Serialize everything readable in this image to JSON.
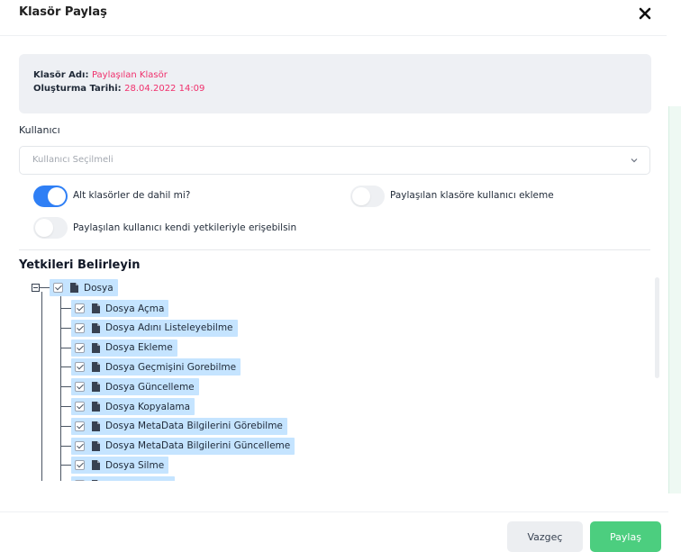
{
  "modal": {
    "title": "Klasör Paylaş",
    "close_icon": "close-icon"
  },
  "folder_info": {
    "name_label": "Klasör Adı:",
    "name_value": "Paylaşılan Klasör",
    "date_label": "Oluşturma Tarihi:",
    "date_value": "28.04.2022 14:09"
  },
  "user_field": {
    "label": "Kullanıcı",
    "placeholder": "Kullanıcı Seçilmeli"
  },
  "toggles": {
    "subfolders": {
      "label": "Alt klasörler de dahil mi?",
      "checked": true
    },
    "add_user": {
      "label": "Paylaşılan klasöre kullanıcı ekleme",
      "checked": false
    },
    "own_permissions": {
      "label": "Paylaşılan kullanıcı kendi yetkileriyle erişebilsin",
      "checked": false
    }
  },
  "permissions": {
    "title": "Yetkileri Belirleyin",
    "root": {
      "label": "Dosya",
      "checked": true,
      "expanded": true
    },
    "children": [
      {
        "label": "Dosya Açma",
        "checked": true
      },
      {
        "label": "Dosya Adını Listeleyebilme",
        "checked": true
      },
      {
        "label": "Dosya Ekleme",
        "checked": true
      },
      {
        "label": "Dosya Geçmişini Gorebilme",
        "checked": true
      },
      {
        "label": "Dosya Güncelleme",
        "checked": true
      },
      {
        "label": "Dosya Kopyalama",
        "checked": true
      },
      {
        "label": "Dosya MetaData Bilgilerini Görebilme",
        "checked": true
      },
      {
        "label": "Dosya MetaData Bilgilerini Güncelleme",
        "checked": true
      },
      {
        "label": "Dosya Silme",
        "checked": true
      },
      {
        "label": "",
        "checked": true
      }
    ]
  },
  "buttons": {
    "cancel": "Vazgeç",
    "share": "Paylaş"
  },
  "colors": {
    "accent": "#f0306c",
    "toggle_on": "#2f7ff5",
    "primary": "#4cce7f",
    "tree_selection": "#c5e4ff"
  }
}
